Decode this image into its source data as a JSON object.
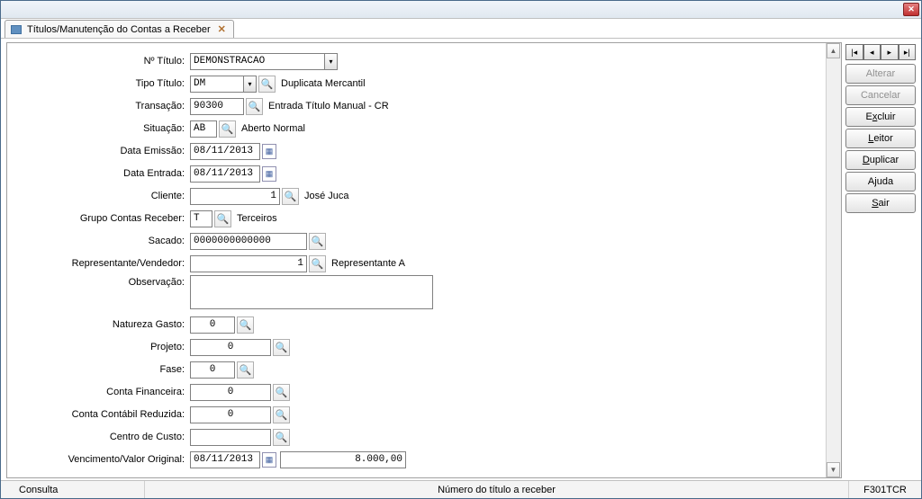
{
  "tab": {
    "title": "Títulos/Manutenção do Contas a Receber"
  },
  "fields": {
    "numero": {
      "label": "Nº Título:",
      "value": "DEMONSTRACAO"
    },
    "tipo": {
      "label": "Tipo Título:",
      "value": "DM",
      "desc": "Duplicata Mercantil"
    },
    "transacao": {
      "label": "Transação:",
      "value": "90300",
      "desc": "Entrada Título Manual - CR"
    },
    "situacao": {
      "label": "Situação:",
      "value": "AB",
      "desc": "Aberto Normal"
    },
    "data_emissao": {
      "label": "Data Emissão:",
      "value": "08/11/2013"
    },
    "data_entrada": {
      "label": "Data Entrada:",
      "value": "08/11/2013"
    },
    "cliente": {
      "label": "Cliente:",
      "value": "1",
      "desc": "José Juca"
    },
    "grupo": {
      "label": "Grupo Contas Receber:",
      "value": "T",
      "desc": "Terceiros"
    },
    "sacado": {
      "label": "Sacado:",
      "value": "0000000000000"
    },
    "repr": {
      "label": "Representante/Vendedor:",
      "value": "1",
      "desc": "Representante A"
    },
    "obs": {
      "label": "Observação:",
      "value": ""
    },
    "natureza": {
      "label": "Natureza Gasto:",
      "value": "0"
    },
    "projeto": {
      "label": "Projeto:",
      "value": "0"
    },
    "fase": {
      "label": "Fase:",
      "value": "0"
    },
    "conta_fin": {
      "label": "Conta Financeira:",
      "value": "0"
    },
    "conta_cont": {
      "label": "Conta Contábil Reduzida:",
      "value": "0"
    },
    "centro": {
      "label": "Centro de Custo:",
      "value": ""
    },
    "venc": {
      "label": "Vencimento/Valor Original:",
      "date": "08/11/2013",
      "valor": "8.000,00"
    }
  },
  "buttons": {
    "alterar": "Alterar",
    "cancelar": "Cancelar",
    "excluir_pre": "E",
    "excluir_u": "x",
    "excluir_post": "cluir",
    "leitor_u": "L",
    "leitor_post": "eitor",
    "duplicar_u": "D",
    "duplicar_post": "uplicar",
    "ajuda_pre": "A",
    "ajuda_u": "j",
    "ajuda_post": "uda",
    "sair_u": "S",
    "sair_post": "air"
  },
  "status": {
    "left": "Consulta",
    "mid": "Número do título a receber",
    "right": "F301TCR"
  }
}
